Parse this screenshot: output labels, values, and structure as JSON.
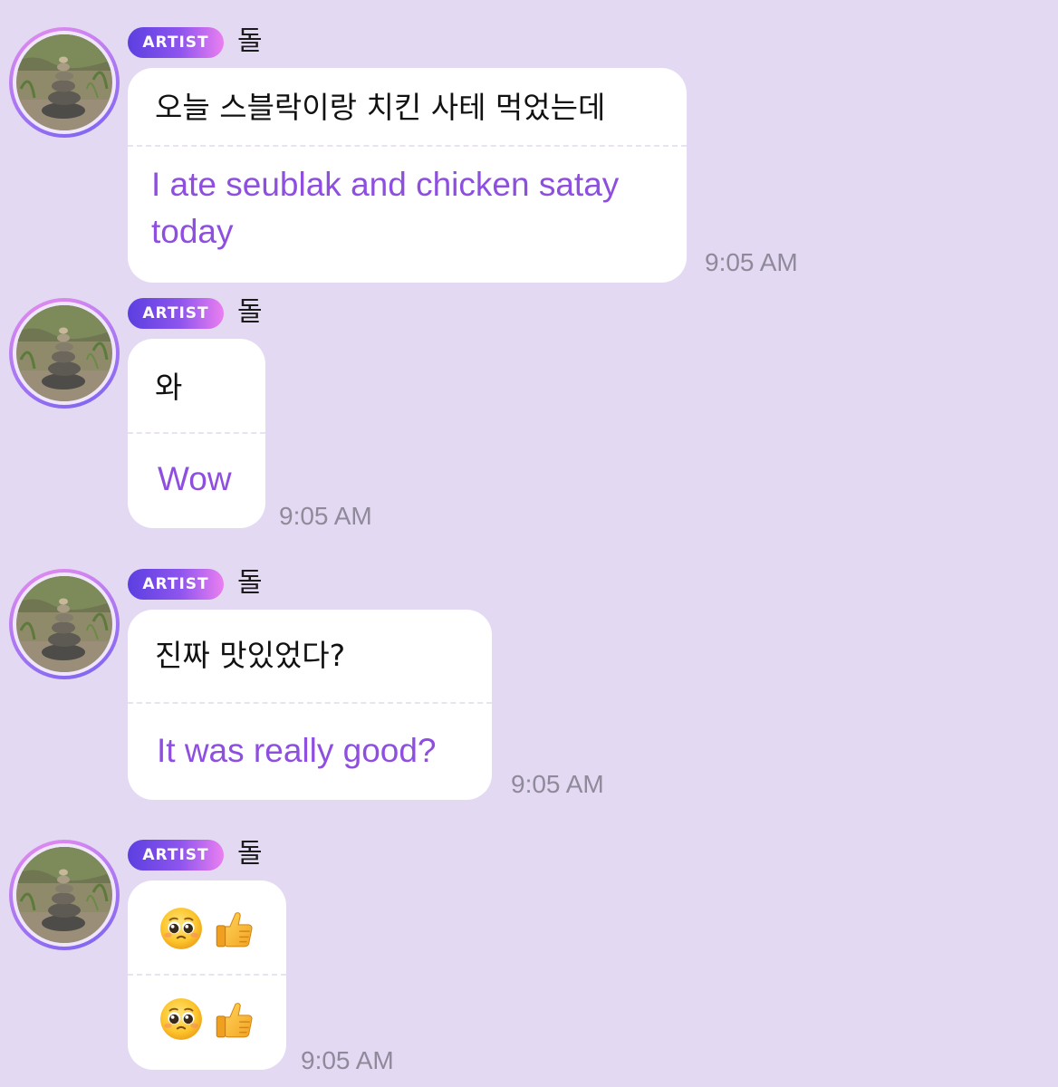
{
  "messages": [
    {
      "badge": "ARTIST",
      "sender": "돌",
      "original": "오늘 스블락이랑 치킨 사테 먹었는데",
      "translation": "I ate seublak and chicken satay today",
      "time": "9:05 AM"
    },
    {
      "badge": "ARTIST",
      "sender": "돌",
      "original": "와",
      "translation": "Wow",
      "time": "9:05 AM"
    },
    {
      "badge": "ARTIST",
      "sender": "돌",
      "original": "진짜 맛있었다?",
      "translation": "It was really good?",
      "time": "9:05 AM"
    },
    {
      "badge": "ARTIST",
      "sender": "돌",
      "original_emoji": [
        "pleading-face-icon",
        "thumbs-up-icon"
      ],
      "translation_emoji": [
        "pleading-face-icon",
        "thumbs-up-icon"
      ],
      "time": "9:05 AM"
    }
  ],
  "colors": {
    "background": "#e4d9f3",
    "bubble": "#ffffff",
    "translation_text": "#8e4fe0",
    "timestamp": "#8f8a99",
    "badge_gradient": [
      "#5b3fe0",
      "#ea7ff0"
    ]
  }
}
